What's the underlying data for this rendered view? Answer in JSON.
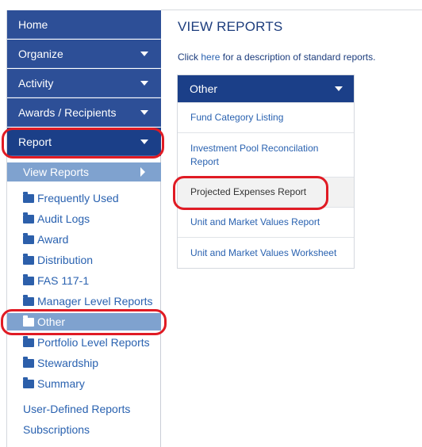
{
  "sidebar": {
    "nav": [
      {
        "label": "Home",
        "has_caret": false
      },
      {
        "label": "Organize",
        "has_caret": true
      },
      {
        "label": "Activity",
        "has_caret": true
      },
      {
        "label": "Awards / Recipients",
        "has_caret": true
      },
      {
        "label": "Report",
        "has_caret": true
      }
    ],
    "sub_nav": {
      "label": "View Reports"
    },
    "folders": [
      {
        "label": "Frequently Used",
        "active": false
      },
      {
        "label": "Audit Logs",
        "active": false
      },
      {
        "label": "Award",
        "active": false
      },
      {
        "label": "Distribution",
        "active": false
      },
      {
        "label": "FAS 117-1",
        "active": false
      },
      {
        "label": "Manager Level Reports",
        "active": false
      },
      {
        "label": "Other",
        "active": true
      },
      {
        "label": "Portfolio Level Reports",
        "active": false
      },
      {
        "label": "Stewardship",
        "active": false
      },
      {
        "label": "Summary",
        "active": false
      }
    ],
    "links": [
      {
        "label": "User-Defined Reports"
      },
      {
        "label": "Subscriptions"
      }
    ]
  },
  "main": {
    "title": "VIEW REPORTS",
    "intro": {
      "prefix": "Click ",
      "link": "here",
      "suffix": " for a description of standard reports."
    },
    "panel": {
      "header": "Other",
      "items": [
        {
          "label": "Fund Category Listing",
          "selected": false
        },
        {
          "label": "Investment Pool Reconcilation Report",
          "selected": false
        },
        {
          "label": "Projected Expenses Report",
          "selected": true
        },
        {
          "label": "Unit and Market Values Report",
          "selected": false
        },
        {
          "label": "Unit and Market Values Worksheet",
          "selected": false
        }
      ]
    }
  },
  "colors": {
    "nav_bg": "#2d4f97",
    "nav_active_bg": "#1b3f88",
    "sub_active_bg": "#7fa2cf",
    "link": "#2a62b0",
    "highlight": "#e01b24"
  }
}
